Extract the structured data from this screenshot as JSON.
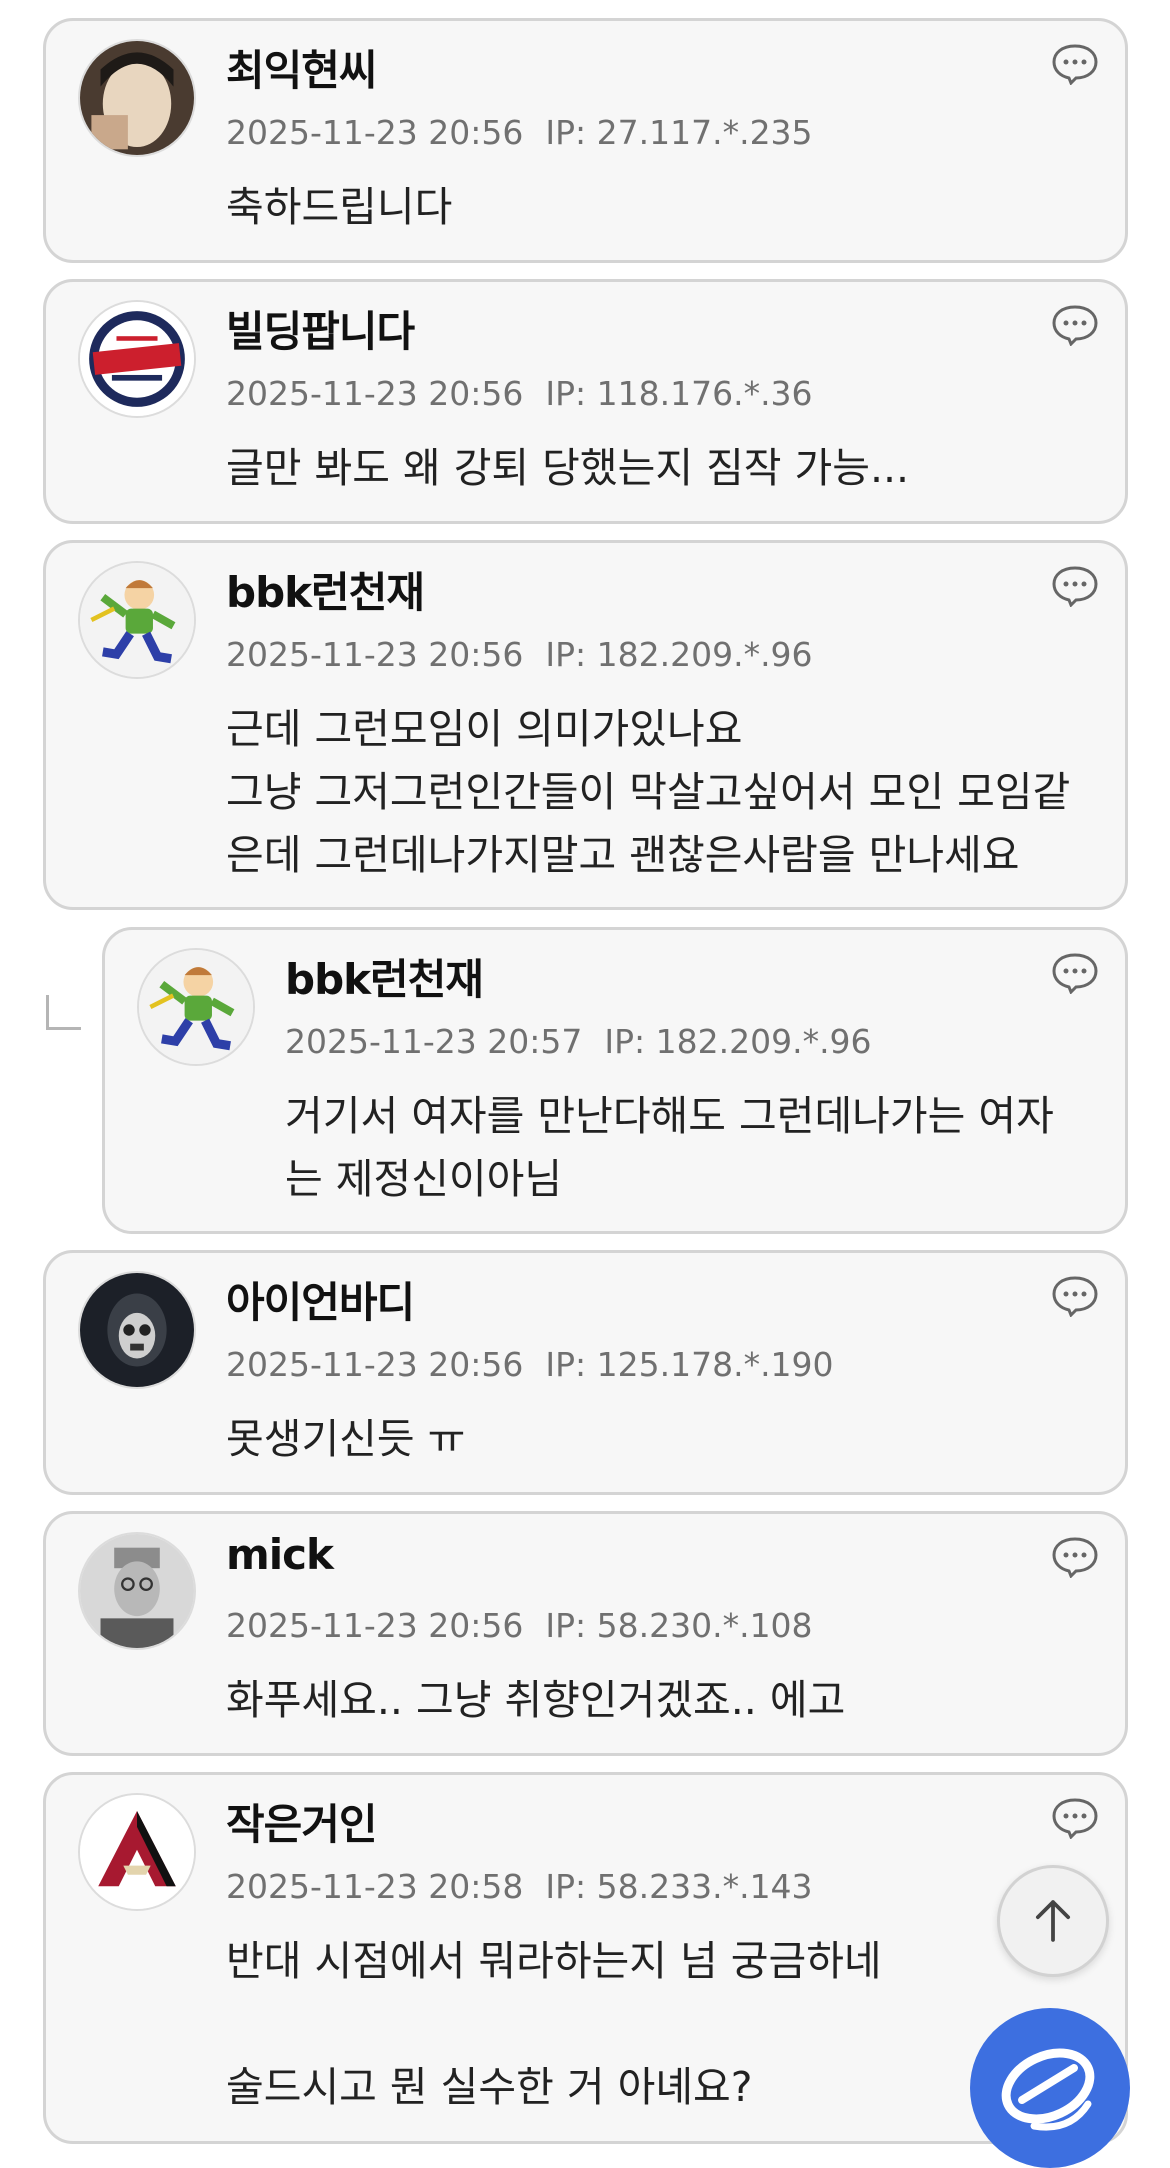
{
  "comments": [
    {
      "name": "최익현씨",
      "date": "2025-11-23 20:56",
      "ip": "IP: 27.117.*.235",
      "lines": [
        "축하드립니다"
      ],
      "avatar": "photo-avatar-man"
    },
    {
      "name": "빌딩팝니다",
      "date": "2025-11-23 20:56",
      "ip": "IP: 118.176.*.36",
      "lines": [
        "글만 봐도 왜 강퇴 당했는지 짐작 가능..."
      ],
      "avatar": "giants-logo-avatar"
    },
    {
      "name": "bbk런천재",
      "date": "2025-11-23 20:56",
      "ip": "IP: 182.209.*.96",
      "lines": [
        "근데 그런모임이 의미가있나요",
        "그냥 그저그런인간들이 막살고싶어서 모인 모임같",
        "은데 그런데나가지말고 괜찮은사람을 만나세요"
      ],
      "avatar": "running-cartoon-avatar"
    },
    {
      "name": "bbk런천재",
      "date": "2025-11-23 20:57",
      "ip": "IP: 182.209.*.96",
      "lines": [
        "거기서 여자를 만난다해도 그런데나가는 여자",
        "는 제정신이아님"
      ],
      "avatar": "running-cartoon-avatar"
    },
    {
      "name": "아이언바디",
      "date": "2025-11-23 20:56",
      "ip": "IP: 125.178.*.190",
      "lines": [
        "못생기신듯 ㅠ"
      ],
      "avatar": "skull-mask-avatar"
    },
    {
      "name": "mick",
      "date": "2025-11-23 20:56",
      "ip": "IP: 58.230.*.108",
      "lines": [
        "화푸세요.. 그냥 취향인거겠죠.. 에고"
      ],
      "avatar": "portrait-avatar"
    },
    {
      "name": "작은거인",
      "date": "2025-11-23 20:58",
      "ip": "IP: 58.233.*.143",
      "lines": [
        "반대 시점에서 뭐라하는지 넘 궁금하네",
        "",
        "술드시고 뭔 실수한 거 아녜요?"
      ],
      "avatar": "diamondbacks-logo-avatar"
    }
  ],
  "icons": {
    "reply": "speech-bubble-icon",
    "scroll_top": "arrow-up-icon",
    "fab": "app-logo-icon"
  },
  "colors": {
    "card_bg": "#f7f7f7",
    "card_border": "#d4d4d4",
    "meta_text": "#707070",
    "fab_blue": "#3d6fe0"
  }
}
